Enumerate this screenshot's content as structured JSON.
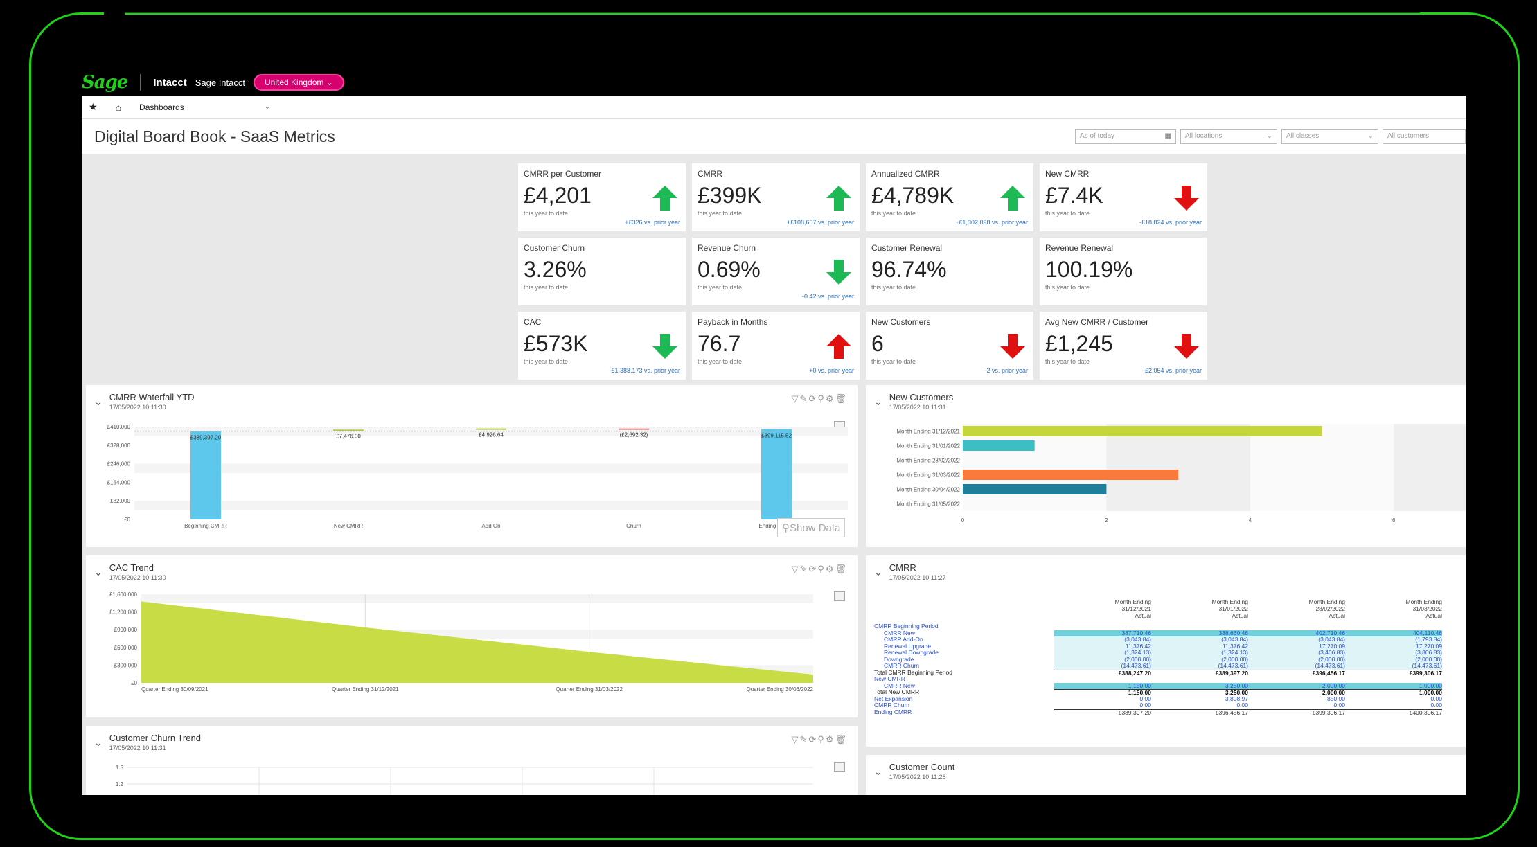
{
  "topbar": {
    "logo": "Sage",
    "brand": "Intacct",
    "brand2": "Sage Intacct",
    "region": "United Kingdom"
  },
  "nav": {
    "label": "Dashboards"
  },
  "page": {
    "title": "Digital Board Book - SaaS Metrics"
  },
  "filters": {
    "date": "As of today",
    "locations": "All locations",
    "classes": "All classes",
    "customers": "All customers"
  },
  "kpis": [
    {
      "title": "CMRR per Customer",
      "value": "£4,201",
      "sub": "this year to date",
      "change": "+£326 vs. prior year",
      "direction": "up",
      "color": "#1db954"
    },
    {
      "title": "CMRR",
      "value": "£399K",
      "sub": "this year to date",
      "change": "+£108,607 vs. prior year",
      "direction": "up",
      "color": "#1db954"
    },
    {
      "title": "Annualized CMRR",
      "value": "£4,789K",
      "sub": "this year to date",
      "change": "+£1,302,098 vs. prior year",
      "direction": "up",
      "color": "#1db954"
    },
    {
      "title": "New CMRR",
      "value": "£7.4K",
      "sub": "this year to date",
      "change": "-£18,824 vs. prior year",
      "direction": "down",
      "color": "#e01010"
    },
    {
      "title": "Customer Churn",
      "value": "3.26%",
      "sub": "this year to date",
      "change": "",
      "direction": "none",
      "color": ""
    },
    {
      "title": "Revenue Churn",
      "value": "0.69%",
      "sub": "this year to date",
      "change": "-0.42 vs. prior year",
      "direction": "down",
      "color": "#1db954"
    },
    {
      "title": "Customer Renewal",
      "value": "96.74%",
      "sub": "this year to date",
      "change": "",
      "direction": "none",
      "color": ""
    },
    {
      "title": "Revenue Renewal",
      "value": "100.19%",
      "sub": "this year to date",
      "change": "",
      "direction": "none",
      "color": ""
    },
    {
      "title": "CAC",
      "value": "£573K",
      "sub": "this year to date",
      "change": "-£1,388,173 vs. prior year",
      "direction": "down",
      "color": "#1db954"
    },
    {
      "title": "Payback in Months",
      "value": "76.7",
      "sub": "this year to date",
      "change": "+0 vs. prior year",
      "direction": "up",
      "color": "#e01010"
    },
    {
      "title": "New Customers",
      "value": "6",
      "sub": "this year to date",
      "change": "-2 vs. prior year",
      "direction": "down",
      "color": "#e01010"
    },
    {
      "title": "Avg New CMRR / Customer",
      "value": "£1,245",
      "sub": "this year to date",
      "change": "-£2,054 vs. prior year",
      "direction": "down",
      "color": "#e01010"
    }
  ],
  "panels": {
    "waterfall": {
      "title": "CMRR Waterfall YTD",
      "date": "17/05/2022 10:11:30",
      "show_data": "Show Data"
    },
    "new_customers": {
      "title": "New Customers",
      "date": "17/05/2022 10:11:31"
    },
    "cac_trend": {
      "title": "CAC Trend",
      "date": "17/05/2022 10:11:30"
    },
    "cmrr": {
      "title": "CMRR",
      "date": "17/05/2022 10:11:27"
    },
    "churn_trend": {
      "title": "Customer Churn Trend",
      "date": "17/05/2022 10:11:31"
    },
    "customer_count": {
      "title": "Customer Count",
      "date": "17/05/2022 10:11:28"
    }
  },
  "chart_data": [
    {
      "type": "bar",
      "title": "CMRR Waterfall YTD",
      "categories": [
        "Beginning CMRR",
        "New CMRR",
        "Add On",
        "Churn",
        "Ending CMRR"
      ],
      "values": [
        389397.2,
        7476.0,
        4926.64,
        -2692.32,
        399115.52
      ],
      "data_labels": [
        "£389,397.20",
        "£7,476.00",
        "£4,926.64",
        "(£2,692.32)",
        "£399,115.52"
      ],
      "yticks": [
        "£410,000",
        "£328,000",
        "£246,000",
        "£164,000",
        "£82,000",
        "£0"
      ],
      "ylim": [
        0,
        410000
      ],
      "color": "#5ec8ec"
    },
    {
      "type": "bar",
      "orientation": "horizontal",
      "title": "New Customers",
      "categories": [
        "Month Ending 31/12/2021",
        "Month Ending 31/01/2022",
        "Month Ending 28/02/2022",
        "Month Ending 31/03/2022",
        "Month Ending 30/04/2022",
        "Month Ending 31/05/2022"
      ],
      "values": [
        5,
        1,
        0,
        3,
        2,
        0
      ],
      "colors": [
        "#c5d63c",
        "#3cbfc4",
        "#cccccc",
        "#f97a3a",
        "#1f7f9a",
        "#cccccc"
      ],
      "xticks": [
        "0",
        "2",
        "4",
        "6"
      ],
      "xlim": [
        0,
        7
      ]
    },
    {
      "type": "area",
      "title": "CAC Trend",
      "categories": [
        "Quarter Ending 30/09/2021",
        "Quarter Ending 31/12/2021",
        "Quarter Ending 31/03/2022",
        "Quarter Ending 30/06/2022"
      ],
      "values": [
        1470000,
        1000000,
        560000,
        150000
      ],
      "yticks": [
        "£1,600,000",
        "£1,200,000",
        "£900,000",
        "£600,000",
        "£300,000",
        "£0"
      ],
      "ylim": [
        0,
        1600000
      ],
      "color": "#c8dc46"
    },
    {
      "type": "line",
      "title": "Customer Churn Trend",
      "yticks": [
        "1.5",
        "1.2"
      ]
    }
  ],
  "cmrr_table": {
    "columns": [
      {
        "l1": "Month Ending",
        "l2": "31/12/2021",
        "l3": "Actual"
      },
      {
        "l1": "Month Ending",
        "l2": "31/01/2022",
        "l3": "Actual"
      },
      {
        "l1": "Month Ending",
        "l2": "28/02/2022",
        "l3": "Actual"
      },
      {
        "l1": "Month Ending",
        "l2": "31/03/2022",
        "l3": "Actual"
      }
    ],
    "rows": [
      {
        "label": "CMRR Beginning Period",
        "style": "blk2",
        "vals": [
          "",
          "",
          "",
          ""
        ]
      },
      {
        "label": "CMRR New",
        "style": "ind hl2",
        "vals": [
          "387,710.46",
          "388,660.46",
          "402,710.46",
          "404,110.46"
        ]
      },
      {
        "label": "CMRR Add-On",
        "style": "ind hl",
        "vals": [
          "(3,043.84)",
          "(3,043.84)",
          "(3,043.84)",
          "(1,793.84)"
        ]
      },
      {
        "label": "Renewal Upgrade",
        "style": "ind hl",
        "vals": [
          "11,376.42",
          "11,376.42",
          "17,270.09",
          "17,270.09"
        ]
      },
      {
        "label": "Renewal Downgrade",
        "style": "ind hl",
        "vals": [
          "(1,324.13)",
          "(1,324.13)",
          "(3,406.83)",
          "(3,806.83)"
        ]
      },
      {
        "label": "Downgrade",
        "style": "ind hl",
        "vals": [
          "(2,000.00)",
          "(2,000.00)",
          "(2,000.00)",
          "(2,000.00)"
        ]
      },
      {
        "label": "CMRR Churn",
        "style": "ind hl",
        "vals": [
          "(14,473.61)",
          "(14,473.61)",
          "(14,473.61)",
          "(14,473.61)"
        ]
      },
      {
        "label": "Total CMRR Beginning Period",
        "style": "blk tot",
        "vals": [
          "£388,247.20",
          "£389,397.20",
          "£396,456.17",
          "£399,306.17"
        ]
      },
      {
        "label": "New CMRR",
        "style": "",
        "vals": [
          "",
          "",
          "",
          ""
        ]
      },
      {
        "label": "CMRR New",
        "style": "ind hl2",
        "vals": [
          "1,150.00",
          "3,250.00",
          "2,000.00",
          "1,000.00"
        ]
      },
      {
        "label": "Total New CMRR",
        "style": "blk tot",
        "vals": [
          "1,150.00",
          "3,250.00",
          "2,000.00",
          "1,000.00"
        ]
      },
      {
        "label": "Net Expansion",
        "style": "",
        "vals": [
          "0.00",
          "3,808.97",
          "850.00",
          "0.00"
        ]
      },
      {
        "label": "CMRR Churn",
        "style": "",
        "vals": [
          "0.00",
          "0.00",
          "0.00",
          "0.00"
        ]
      },
      {
        "label": "Ending CMRR",
        "style": "endr",
        "vals": [
          "£389,397.20",
          "£396,456.17",
          "£399,306.17",
          "£400,306.17"
        ]
      }
    ]
  }
}
